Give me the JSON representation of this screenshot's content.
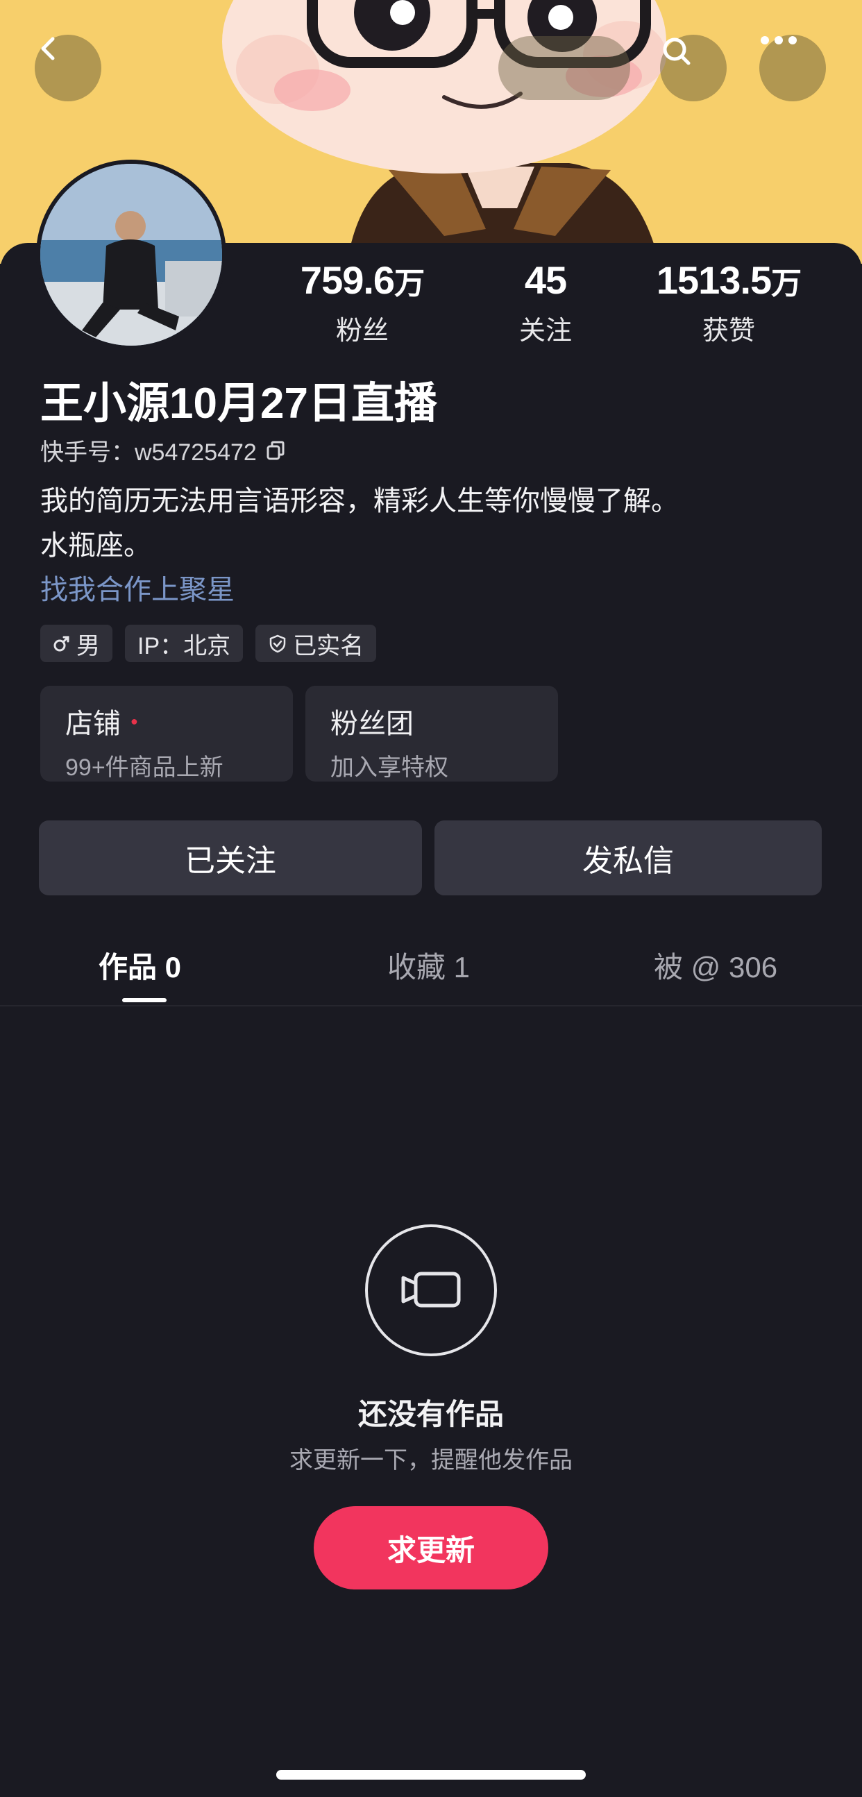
{
  "stats": [
    {
      "value": "759.6",
      "unit": "万",
      "label": "粉丝"
    },
    {
      "value": "45",
      "unit": "",
      "label": "关注"
    },
    {
      "value": "1513.5",
      "unit": "万",
      "label": "获赞"
    }
  ],
  "profile": {
    "name": "王小源10月27日直播",
    "kuaishou_id": "快手号：w54725472",
    "bio_line1": "我的简历无法用言语形容，精彩人生等你慢慢了解。",
    "bio_line2": "水瓶座。",
    "cooperation_link": "找我合作上聚星"
  },
  "tags": [
    {
      "icon": "male-icon",
      "label": "男"
    },
    {
      "icon": "",
      "label": "IP：北京"
    },
    {
      "icon": "shield-icon",
      "label": "已实名"
    }
  ],
  "cards": [
    {
      "title": "店铺",
      "subtitle": "99+件商品上新"
    },
    {
      "title": "粉丝团",
      "subtitle": "加入享特权"
    }
  ],
  "actions": {
    "followed": "已关注",
    "message": "发私信"
  },
  "tabs": [
    {
      "label": "作品 0"
    },
    {
      "label": "收藏 1"
    },
    {
      "label": "被 @ 306"
    }
  ],
  "empty_state": {
    "title": "还没有作品",
    "subtitle": "求更新一下，提醒他发作品",
    "button": "求更新"
  },
  "colors": {
    "banner": "#f7cf6b",
    "background": "#1a1a22",
    "accent": "#f2355e",
    "link": "#7b96c8"
  }
}
